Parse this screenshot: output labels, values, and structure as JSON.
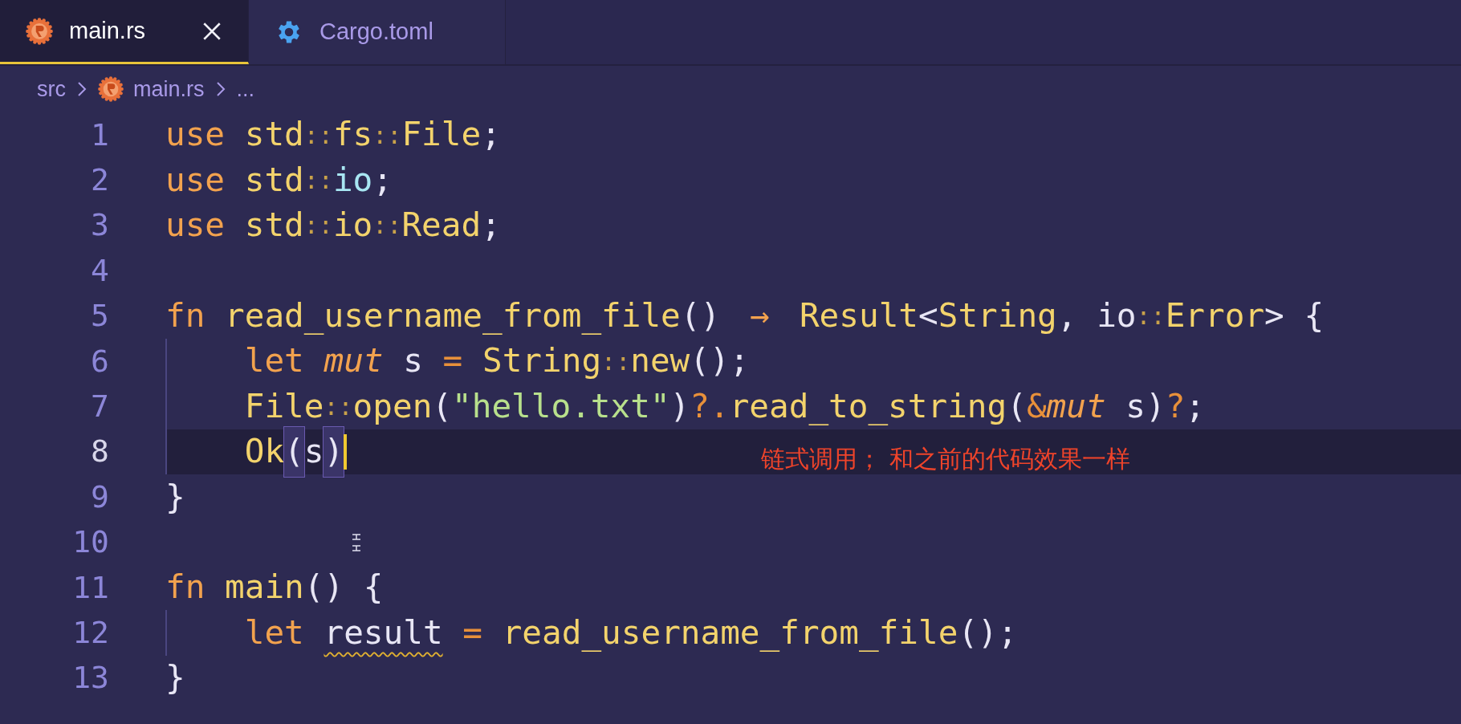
{
  "tabs": [
    {
      "label": "main.rs",
      "kind": "rust",
      "selected": true,
      "closable": true
    },
    {
      "label": "Cargo.toml",
      "kind": "settings",
      "selected": false
    }
  ],
  "breadcrumb": [
    {
      "label": "src",
      "kind": "folder"
    },
    {
      "label": "main.rs",
      "kind": "rust"
    },
    {
      "label": "...",
      "kind": "more"
    }
  ],
  "lines": [
    {
      "number": "1",
      "tokens": [
        {
          "text": "use ",
          "kind": "keyword"
        },
        {
          "text": "std",
          "kind": "type"
        },
        {
          "text": "::",
          "kind": "sep"
        },
        {
          "text": "fs",
          "kind": "type"
        },
        {
          "text": "::",
          "kind": "sep"
        },
        {
          "text": "File",
          "kind": "type"
        },
        {
          "text": ";",
          "kind": "punct"
        }
      ]
    },
    {
      "number": "2",
      "tokens": [
        {
          "text": "use ",
          "kind": "keyword"
        },
        {
          "text": "std",
          "kind": "type"
        },
        {
          "text": "::",
          "kind": "sep"
        },
        {
          "text": "io",
          "kind": "module"
        },
        {
          "text": ";",
          "kind": "punct"
        }
      ]
    },
    {
      "number": "3",
      "tokens": [
        {
          "text": "use ",
          "kind": "keyword"
        },
        {
          "text": "std",
          "kind": "type"
        },
        {
          "text": "::",
          "kind": "sep"
        },
        {
          "text": "io",
          "kind": "type"
        },
        {
          "text": "::",
          "kind": "sep"
        },
        {
          "text": "Read",
          "kind": "type"
        },
        {
          "text": ";",
          "kind": "punct"
        }
      ]
    },
    {
      "number": "4"
    },
    {
      "number": "5",
      "tokens": [
        {
          "text": "fn ",
          "kind": "keyword"
        },
        {
          "text": "read_username_from_file",
          "kind": "func"
        },
        {
          "text": "() ",
          "kind": "punct"
        },
        {
          "text": "→",
          "kind": "arrow"
        },
        {
          "text": " Result",
          "kind": "type"
        },
        {
          "text": "<",
          "kind": "punct"
        },
        {
          "text": "String",
          "kind": "type"
        },
        {
          "text": ", io",
          "kind": "punct"
        },
        {
          "text": "::",
          "kind": "sep"
        },
        {
          "text": "Error",
          "kind": "type"
        },
        {
          "text": "> {",
          "kind": "punct"
        }
      ]
    },
    {
      "number": "6",
      "indented": true,
      "tokens": [
        {
          "text": "let ",
          "kind": "keyword"
        },
        {
          "text": "mut",
          "kind": "modifier"
        },
        {
          "text": " s ",
          "kind": "var"
        },
        {
          "text": "= ",
          "kind": "operator"
        },
        {
          "text": "String",
          "kind": "type"
        },
        {
          "text": "::",
          "kind": "sep"
        },
        {
          "text": "new",
          "kind": "func"
        },
        {
          "text": "();",
          "kind": "punct"
        }
      ]
    },
    {
      "number": "7",
      "indented": true,
      "tokens": [
        {
          "text": "File",
          "kind": "type"
        },
        {
          "text": "::",
          "kind": "sep"
        },
        {
          "text": "open",
          "kind": "func"
        },
        {
          "text": "(",
          "kind": "punct"
        },
        {
          "text": "\"hello.txt\"",
          "kind": "string"
        },
        {
          "text": ")",
          "kind": "punct"
        },
        {
          "text": "?.",
          "kind": "operator"
        },
        {
          "text": "read_to_string",
          "kind": "func"
        },
        {
          "text": "(",
          "kind": "punct"
        },
        {
          "text": "&",
          "kind": "operator"
        },
        {
          "text": "mut",
          "kind": "modifier"
        },
        {
          "text": " s)",
          "kind": "var"
        },
        {
          "text": "?",
          "kind": "operator"
        },
        {
          "text": ";",
          "kind": "punct"
        }
      ]
    },
    {
      "number": "8",
      "indented": true,
      "current": true,
      "cursor": true,
      "note": "链式调用； 和之前的代码效果一样",
      "tokens": [
        {
          "text": "Ok",
          "kind": "type"
        },
        {
          "text": "(",
          "kind": "bracket"
        },
        {
          "text": "s",
          "kind": "var"
        },
        {
          "text": ")",
          "kind": "bracket"
        }
      ]
    },
    {
      "number": "9",
      "tokens": [
        {
          "text": "}",
          "kind": "punct"
        }
      ]
    },
    {
      "number": "10",
      "pointer": true
    },
    {
      "number": "11",
      "tokens": [
        {
          "text": "fn ",
          "kind": "keyword"
        },
        {
          "text": "main",
          "kind": "func"
        },
        {
          "text": "() {",
          "kind": "punct"
        }
      ]
    },
    {
      "number": "12",
      "indented": true,
      "tokens": [
        {
          "text": "let ",
          "kind": "keyword"
        },
        {
          "text": "result",
          "kind": "var",
          "warning": true
        },
        {
          "text": " = ",
          "kind": "operator"
        },
        {
          "text": "read_username_from_file",
          "kind": "func"
        },
        {
          "text": "();",
          "kind": "punct"
        }
      ]
    },
    {
      "number": "13",
      "tokens": [
        {
          "text": "}",
          "kind": "punct"
        }
      ]
    }
  ]
}
